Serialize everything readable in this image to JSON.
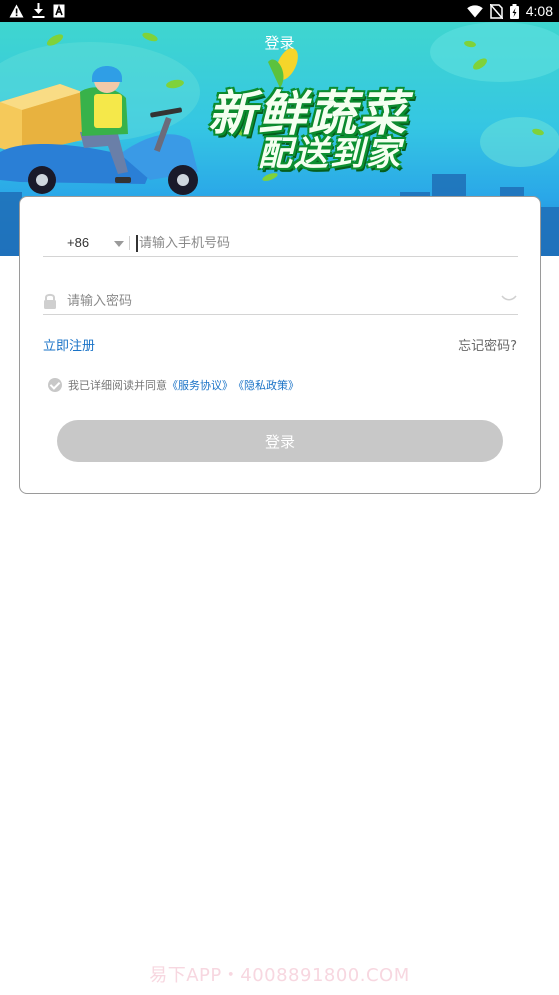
{
  "status_bar": {
    "time": "4:08",
    "left_icons": [
      "warning-icon",
      "download-icon",
      "a-box-icon"
    ],
    "right_icons": [
      "wifi-icon",
      "no-sim-icon",
      "battery-charging-icon"
    ]
  },
  "header": {
    "title": "登录"
  },
  "banner": {
    "slogan_line1": "新鲜蔬菜",
    "slogan_line2": "配送到家"
  },
  "form": {
    "country_code": "+86",
    "phone_placeholder": "请输入手机号码",
    "password_placeholder": "请输入密码",
    "register_label": "立即注册",
    "forgot_label": "忘记密码?",
    "agreement_prefix": "我已详细阅读并同意",
    "service_link": "《服务协议》",
    "privacy_link": "《隐私政策》",
    "login_label": "登录"
  },
  "watermark": "易下APP・4008891800.COM",
  "colors": {
    "link_blue": "#1a73c7",
    "button_disabled": "#c8c8c8",
    "banner_top": "#3fd6cf",
    "banner_bottom": "#1f7fd1",
    "slogan_green": "#0c8f30"
  }
}
